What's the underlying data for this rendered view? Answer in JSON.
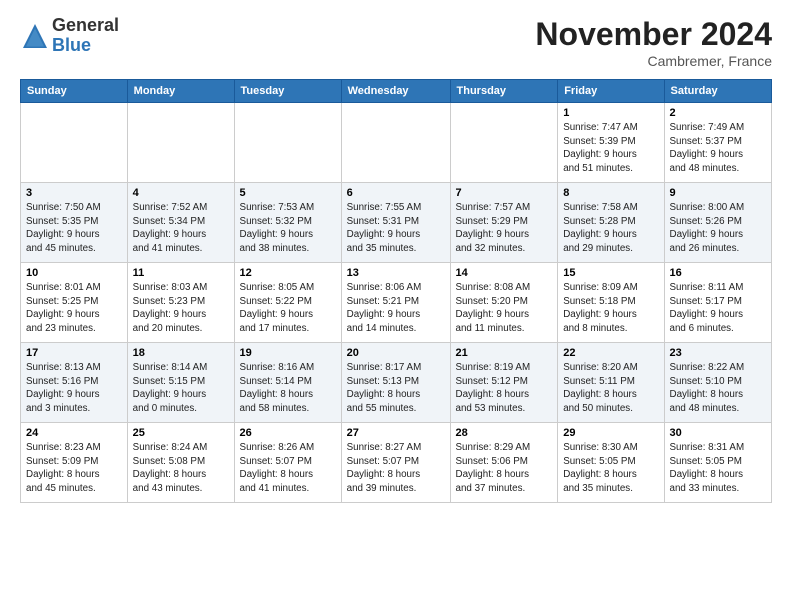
{
  "logo": {
    "general": "General",
    "blue": "Blue"
  },
  "header": {
    "month": "November 2024",
    "location": "Cambremer, France"
  },
  "weekdays": [
    "Sunday",
    "Monday",
    "Tuesday",
    "Wednesday",
    "Thursday",
    "Friday",
    "Saturday"
  ],
  "weeks": [
    [
      {
        "day": "",
        "info": ""
      },
      {
        "day": "",
        "info": ""
      },
      {
        "day": "",
        "info": ""
      },
      {
        "day": "",
        "info": ""
      },
      {
        "day": "",
        "info": ""
      },
      {
        "day": "1",
        "info": "Sunrise: 7:47 AM\nSunset: 5:39 PM\nDaylight: 9 hours\nand 51 minutes."
      },
      {
        "day": "2",
        "info": "Sunrise: 7:49 AM\nSunset: 5:37 PM\nDaylight: 9 hours\nand 48 minutes."
      }
    ],
    [
      {
        "day": "3",
        "info": "Sunrise: 7:50 AM\nSunset: 5:35 PM\nDaylight: 9 hours\nand 45 minutes."
      },
      {
        "day": "4",
        "info": "Sunrise: 7:52 AM\nSunset: 5:34 PM\nDaylight: 9 hours\nand 41 minutes."
      },
      {
        "day": "5",
        "info": "Sunrise: 7:53 AM\nSunset: 5:32 PM\nDaylight: 9 hours\nand 38 minutes."
      },
      {
        "day": "6",
        "info": "Sunrise: 7:55 AM\nSunset: 5:31 PM\nDaylight: 9 hours\nand 35 minutes."
      },
      {
        "day": "7",
        "info": "Sunrise: 7:57 AM\nSunset: 5:29 PM\nDaylight: 9 hours\nand 32 minutes."
      },
      {
        "day": "8",
        "info": "Sunrise: 7:58 AM\nSunset: 5:28 PM\nDaylight: 9 hours\nand 29 minutes."
      },
      {
        "day": "9",
        "info": "Sunrise: 8:00 AM\nSunset: 5:26 PM\nDaylight: 9 hours\nand 26 minutes."
      }
    ],
    [
      {
        "day": "10",
        "info": "Sunrise: 8:01 AM\nSunset: 5:25 PM\nDaylight: 9 hours\nand 23 minutes."
      },
      {
        "day": "11",
        "info": "Sunrise: 8:03 AM\nSunset: 5:23 PM\nDaylight: 9 hours\nand 20 minutes."
      },
      {
        "day": "12",
        "info": "Sunrise: 8:05 AM\nSunset: 5:22 PM\nDaylight: 9 hours\nand 17 minutes."
      },
      {
        "day": "13",
        "info": "Sunrise: 8:06 AM\nSunset: 5:21 PM\nDaylight: 9 hours\nand 14 minutes."
      },
      {
        "day": "14",
        "info": "Sunrise: 8:08 AM\nSunset: 5:20 PM\nDaylight: 9 hours\nand 11 minutes."
      },
      {
        "day": "15",
        "info": "Sunrise: 8:09 AM\nSunset: 5:18 PM\nDaylight: 9 hours\nand 8 minutes."
      },
      {
        "day": "16",
        "info": "Sunrise: 8:11 AM\nSunset: 5:17 PM\nDaylight: 9 hours\nand 6 minutes."
      }
    ],
    [
      {
        "day": "17",
        "info": "Sunrise: 8:13 AM\nSunset: 5:16 PM\nDaylight: 9 hours\nand 3 minutes."
      },
      {
        "day": "18",
        "info": "Sunrise: 8:14 AM\nSunset: 5:15 PM\nDaylight: 9 hours\nand 0 minutes."
      },
      {
        "day": "19",
        "info": "Sunrise: 8:16 AM\nSunset: 5:14 PM\nDaylight: 8 hours\nand 58 minutes."
      },
      {
        "day": "20",
        "info": "Sunrise: 8:17 AM\nSunset: 5:13 PM\nDaylight: 8 hours\nand 55 minutes."
      },
      {
        "day": "21",
        "info": "Sunrise: 8:19 AM\nSunset: 5:12 PM\nDaylight: 8 hours\nand 53 minutes."
      },
      {
        "day": "22",
        "info": "Sunrise: 8:20 AM\nSunset: 5:11 PM\nDaylight: 8 hours\nand 50 minutes."
      },
      {
        "day": "23",
        "info": "Sunrise: 8:22 AM\nSunset: 5:10 PM\nDaylight: 8 hours\nand 48 minutes."
      }
    ],
    [
      {
        "day": "24",
        "info": "Sunrise: 8:23 AM\nSunset: 5:09 PM\nDaylight: 8 hours\nand 45 minutes."
      },
      {
        "day": "25",
        "info": "Sunrise: 8:24 AM\nSunset: 5:08 PM\nDaylight: 8 hours\nand 43 minutes."
      },
      {
        "day": "26",
        "info": "Sunrise: 8:26 AM\nSunset: 5:07 PM\nDaylight: 8 hours\nand 41 minutes."
      },
      {
        "day": "27",
        "info": "Sunrise: 8:27 AM\nSunset: 5:07 PM\nDaylight: 8 hours\nand 39 minutes."
      },
      {
        "day": "28",
        "info": "Sunrise: 8:29 AM\nSunset: 5:06 PM\nDaylight: 8 hours\nand 37 minutes."
      },
      {
        "day": "29",
        "info": "Sunrise: 8:30 AM\nSunset: 5:05 PM\nDaylight: 8 hours\nand 35 minutes."
      },
      {
        "day": "30",
        "info": "Sunrise: 8:31 AM\nSunset: 5:05 PM\nDaylight: 8 hours\nand 33 minutes."
      }
    ]
  ]
}
